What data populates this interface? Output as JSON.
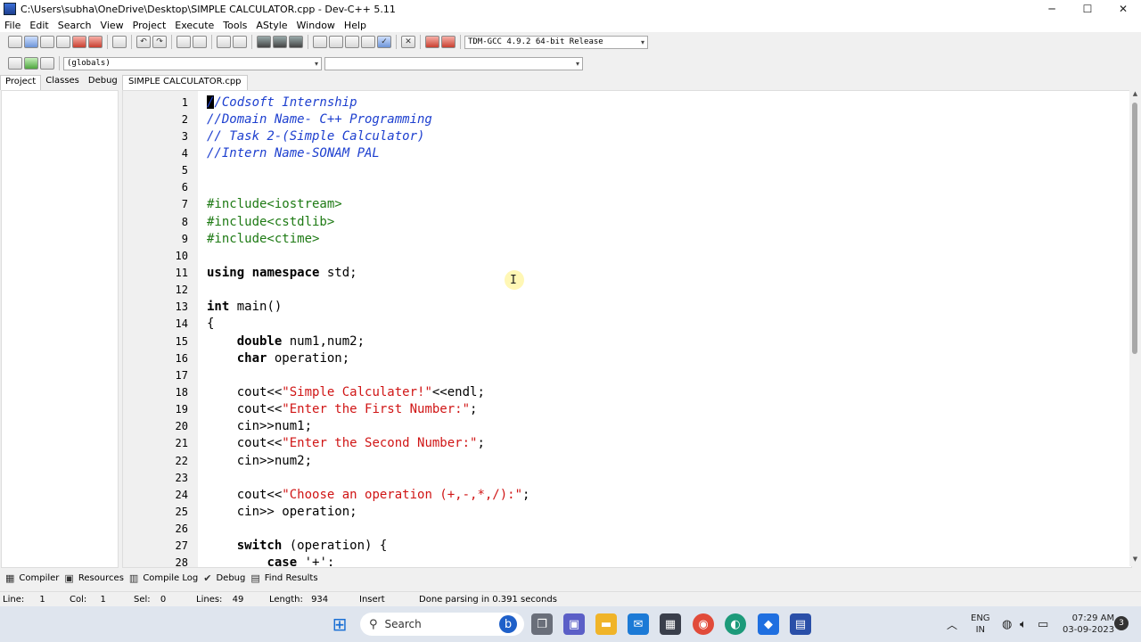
{
  "window": {
    "title": "C:\\Users\\subha\\OneDrive\\Desktop\\SIMPLE CALCULATOR.cpp - Dev-C++ 5.11",
    "minimize": "─",
    "maximize": "☐",
    "close": "✕"
  },
  "menu": [
    "File",
    "Edit",
    "Search",
    "View",
    "Project",
    "Execute",
    "Tools",
    "AStyle",
    "Window",
    "Help"
  ],
  "toolbar": {
    "compiler": "TDM-GCC 4.9.2 64-bit Release",
    "scope": "(globals)",
    "member": ""
  },
  "left_tabs": [
    "Project",
    "Classes",
    "Debug"
  ],
  "editor_tab": "SIMPLE CALCULATOR.cpp",
  "code": [
    "//Codsoft Internship",
    "//Domain Name- C++ Programming",
    "// Task 2-(Simple Calculator)",
    "//Intern Name-SONAM PAL",
    "",
    "",
    "#include<iostream>",
    "#include<cstdlib>",
    "#include<ctime>",
    "",
    "using namespace std;",
    "",
    "int main()",
    "{",
    "    double num1,num2;",
    "    char operation;",
    "",
    "    cout<<\"Simple Calculater!\"<<endl;",
    "    cout<<\"Enter the First Number:\";",
    "    cin>>num1;",
    "    cout<<\"Enter the Second Number:\";",
    "    cin>>num2;",
    "",
    "    cout<<\"Choose an operation (+,-,*,/):\";",
    "    cin>> operation;",
    "",
    "    switch (operation) {",
    "        case '+':"
  ],
  "bottom_tabs": [
    "Compiler",
    "Resources",
    "Compile Log",
    "Debug",
    "Find Results"
  ],
  "status": {
    "line_label": "Line:",
    "line": "1",
    "col_label": "Col:",
    "col": "1",
    "sel_label": "Sel:",
    "sel": "0",
    "lines_label": "Lines:",
    "lines": "49",
    "length_label": "Length:",
    "length": "934",
    "mode": "Insert",
    "message": "Done parsing in 0.391 seconds"
  },
  "taskbar": {
    "search": "Search",
    "lang_top": "ENG",
    "lang_bottom": "IN",
    "time": "07:29 AM",
    "date": "03-09-2023",
    "notification_count": "3"
  },
  "colors": {
    "comment": "#1d3fcf",
    "preprocessor": "#1e7a14",
    "string": "#d01515",
    "taskbar": "#dfe5ee"
  }
}
